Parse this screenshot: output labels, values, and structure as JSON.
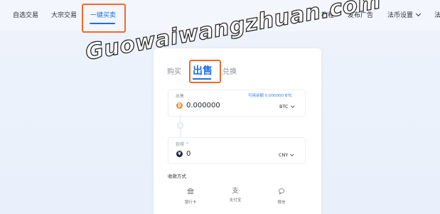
{
  "nav": {
    "items": [
      {
        "label": "自选交易"
      },
      {
        "label": "大宗交易"
      },
      {
        "label": "一键买卖"
      },
      {
        "label": "教程"
      },
      {
        "label": "发布广告"
      },
      {
        "label": "法币设置"
      },
      {
        "label": "法"
      }
    ],
    "active_index": 2
  },
  "watermark": "Guowaiwangzhuan.com",
  "card": {
    "tabs": [
      {
        "label": "购买"
      },
      {
        "label": "出售"
      },
      {
        "label": "兑换"
      }
    ],
    "active_tab": 1,
    "sell": {
      "label": "出售",
      "available_text": "可用余额 0.000000 BTC",
      "coin_icon": "₿",
      "value": "0.000000",
      "unit": "BTC"
    },
    "receive": {
      "label": "获得 ^",
      "coin_icon": "¥",
      "value": "0",
      "unit": "CNY"
    },
    "payment": {
      "title": "收款方式",
      "methods": [
        {
          "icon": "bank-icon",
          "glyph": "🏛",
          "label": "银行卡"
        },
        {
          "icon": "alipay-icon",
          "glyph": "支",
          "label": "支付宝"
        },
        {
          "icon": "wechat-icon",
          "glyph": "◍",
          "label": "微信"
        }
      ]
    }
  },
  "colors": {
    "accent": "#1e6fe8",
    "highlight": "#f06a2c",
    "btc": "#e8923a",
    "cny": "#1f2a44"
  }
}
